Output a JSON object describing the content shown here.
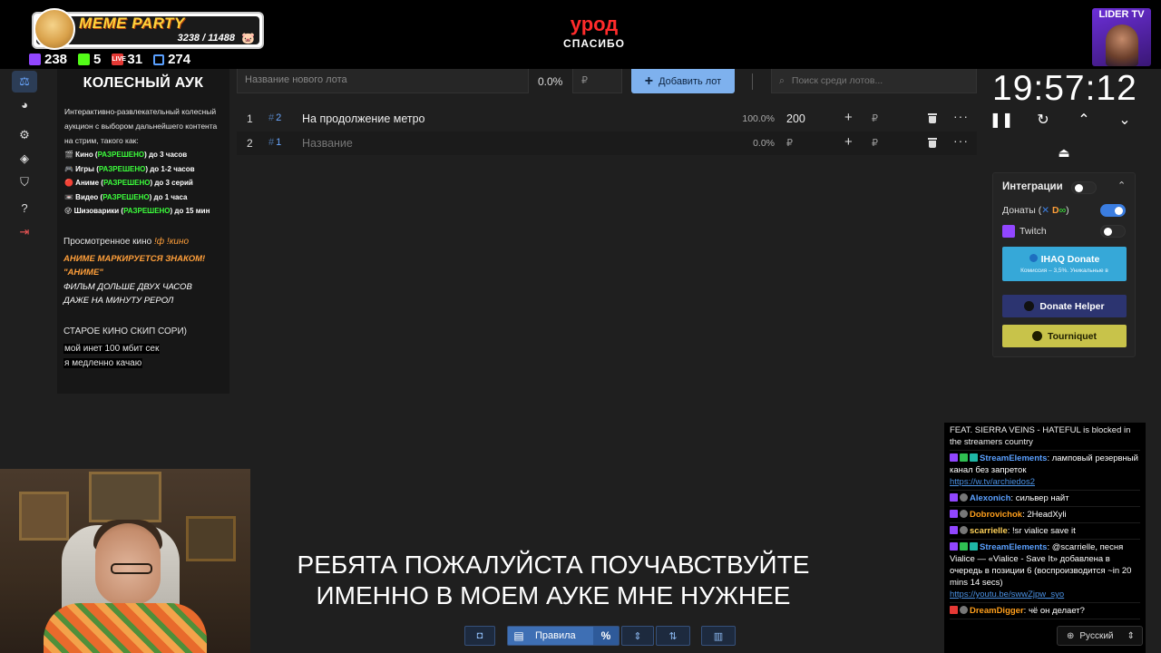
{
  "overlay": {
    "meme_title": "MEME PARTY",
    "meme_count": "3238 / 11488",
    "stats": [
      {
        "icon": "twitch-icon",
        "value": "238"
      },
      {
        "icon": "kick-icon",
        "value": "5"
      },
      {
        "icon": "vk-live-icon",
        "value": "31"
      },
      {
        "icon": "viewers-icon",
        "value": "274"
      }
    ],
    "alert_title": "урод",
    "alert_sub": "СПАСИБО",
    "lider_name": "LIDER TV"
  },
  "sidebar": {
    "items": [
      {
        "icon": "wheel-auction-icon",
        "active": true
      },
      {
        "icon": "pie-chart-icon"
      },
      {
        "icon": "gear-icon"
      },
      {
        "icon": "layers-icon"
      },
      {
        "icon": "shield-check-icon"
      },
      {
        "icon": "help-icon"
      },
      {
        "icon": "logout-icon"
      }
    ]
  },
  "info": {
    "heading": "КОЛЕСНЫЙ АУК",
    "desc": "Интерактивно-развлекательный колесный аукцион с выбором дальнейшего контента на стрим, такого как:",
    "rules": [
      {
        "pre": "🎬 Кино (",
        "ok": "РАЗРЕШЕНО",
        "post": ") до 3 часов"
      },
      {
        "pre": "🎮 Игры (",
        "ok": "РАЗРЕШЕНО",
        "post": ") до 1-2 часов"
      },
      {
        "pre": "🔴 Аниме (",
        "ok": "РАЗРЕШЕНО",
        "post": ") до 3 серий"
      },
      {
        "pre": "📼 Видео (",
        "ok": "РАЗРЕШЕНО",
        "post": ") до 1 часа"
      },
      {
        "pre": "😜 Шизоварики (",
        "ok": "РАЗРЕШЕНО",
        "post": ") до 15 мин"
      }
    ],
    "seen_label": "Просмотренное кино ",
    "seen_cmd": "!ф !кино",
    "orange_1": "АНИМЕ МАРКИРУЕТСЯ ЗНАКОМ!",
    "orange_2": "\"АНИМЕ\"",
    "white_1": "ФИЛЬМ ДОЛЬШЕ ДВУХ ЧАСОВ",
    "white_2": "ДАЖЕ НА МИНУТУ РЕРОЛ",
    "old": "СТАРОЕ КИНО СКИП СОРИ)",
    "inet_1": "мой инет 100 мбит сек",
    "inet_2": "я медленно качаю"
  },
  "toolbar": {
    "name_placeholder": "Название нового лота",
    "percent": "0.0%",
    "currency_placeholder": "₽",
    "add_label": "Добавить лот",
    "search_placeholder": "Поиск среди лотов..."
  },
  "lots": [
    {
      "n": "1",
      "id": "2",
      "name": "На продолжение метро",
      "pct": "100.0%",
      "amount": "200",
      "currency": "₽"
    },
    {
      "n": "2",
      "id": "1",
      "name": "Название",
      "pct": "0.0%",
      "amount": "₽",
      "currency": "₽"
    }
  ],
  "timer": {
    "time": "19:57:12"
  },
  "integrations": {
    "title": "Интеграции",
    "donations_label": "Донаты (",
    "donations_label_end": ")",
    "twitch_label": "Twitch",
    "ihaq_label": "IHAQ Donate",
    "ihaq_sub": "Комиссия – 3,5%. Уникальные в",
    "donate_helper": "Donate Helper",
    "tourniquet": "Tourniquet",
    "toggles": {
      "integrations": false,
      "donations": true,
      "twitch": false
    }
  },
  "chat": {
    "top_cut": "FEAT. SIERRA VEINS - HATEFUL is blocked in the streamers country",
    "messages": [
      {
        "user": "StreamElements",
        "cls": "u-se",
        "text": "ламповый резервный канал без запреток",
        "link": "https://w.tv/archiedos2"
      },
      {
        "user": "Alexonich",
        "cls": "u-al",
        "text": "сильвер найт"
      },
      {
        "user": "Dobrovichok",
        "cls": "u-do",
        "text": "2HeadXyli"
      },
      {
        "user": "scarrielle",
        "cls": "u-sc",
        "text": "!sr vialice save it"
      },
      {
        "user": "StreamElements",
        "cls": "u-se",
        "text": "@scarrielle, песня Vialice — «Vialice - Save It» добавлена в очередь в позиции 6 (воспроизводится ~in 20 mins 14 secs)",
        "link": "https://youtu.be/swwZjpw_syo"
      },
      {
        "user": "DreamDigger",
        "cls": "u-dd",
        "text": "чё он делает?"
      }
    ],
    "language": "Русский"
  },
  "subtitle": {
    "line1": "РЕБЯТА ПОЖАЛУЙСТА ПОУЧАВСТВУЙТЕ",
    "line2": "ИМЕННО В МОЕМ АУКЕ МНЕ НУЖНЕЕ"
  },
  "bottom": {
    "rules_label": "Правила",
    "percent_label": "%"
  }
}
